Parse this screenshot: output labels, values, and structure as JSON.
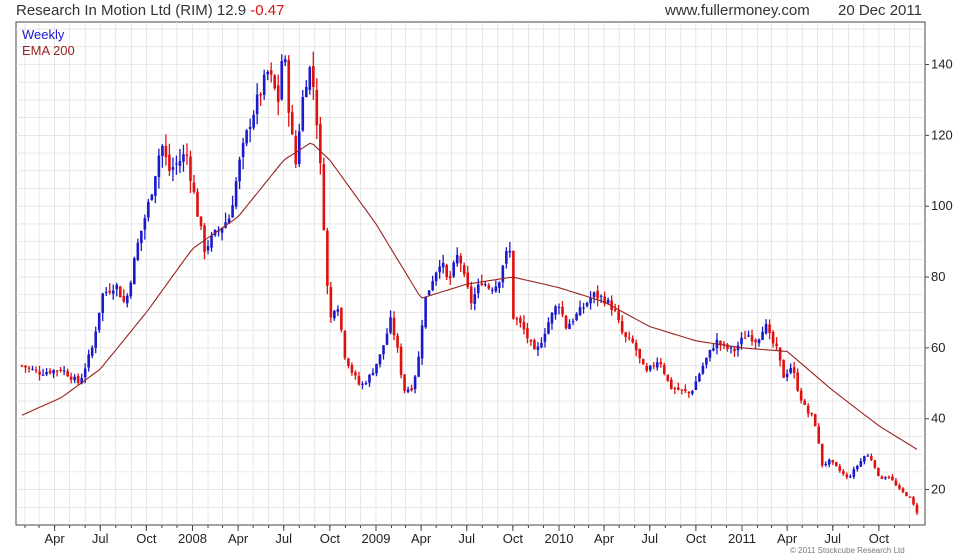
{
  "header": {
    "instrument": "Research In Motion Ltd (RIM)",
    "last": "12.9",
    "change": "-0.47",
    "site": "www.fullermoney.com",
    "date": "20 Dec 2011",
    "copyright": "© 2011 Stockcube Research Ltd"
  },
  "colors": {
    "up": "#1a1acc",
    "down": "#e01010",
    "ema": "#992222",
    "grid": "#d8d8d8",
    "border": "#444444"
  },
  "chart_data": {
    "type": "candlestick",
    "legend": [
      "Weekly",
      "EMA 200"
    ],
    "x_range": [
      "2007-01-26",
      "2011-12-20"
    ],
    "ylim": [
      10,
      152
    ],
    "y_ticks": [
      20,
      40,
      60,
      80,
      100,
      120,
      140
    ],
    "x_ticks": [
      {
        "date": "2007-04-01",
        "label": "Apr"
      },
      {
        "date": "2007-07-01",
        "label": "Jul"
      },
      {
        "date": "2007-10-01",
        "label": "Oct"
      },
      {
        "date": "2008-01-01",
        "label": "2008"
      },
      {
        "date": "2008-04-01",
        "label": "Apr"
      },
      {
        "date": "2008-07-01",
        "label": "Jul"
      },
      {
        "date": "2008-10-01",
        "label": "Oct"
      },
      {
        "date": "2009-01-01",
        "label": "2009"
      },
      {
        "date": "2009-04-01",
        "label": "Apr"
      },
      {
        "date": "2009-07-01",
        "label": "Jul"
      },
      {
        "date": "2009-10-01",
        "label": "Oct"
      },
      {
        "date": "2010-01-01",
        "label": "2010"
      },
      {
        "date": "2010-04-01",
        "label": "Apr"
      },
      {
        "date": "2010-07-01",
        "label": "Jul"
      },
      {
        "date": "2010-10-01",
        "label": "Oct"
      },
      {
        "date": "2011-01-01",
        "label": "2011"
      },
      {
        "date": "2011-04-01",
        "label": "Apr"
      },
      {
        "date": "2011-07-01",
        "label": "Jul"
      },
      {
        "date": "2011-10-01",
        "label": "Oct"
      }
    ],
    "close_anchors": [
      [
        "2007-01-26",
        55
      ],
      [
        "2007-03-01",
        53
      ],
      [
        "2007-04-15",
        54
      ],
      [
        "2007-05-20",
        50
      ],
      [
        "2007-06-15",
        60
      ],
      [
        "2007-07-05",
        75
      ],
      [
        "2007-08-01",
        78
      ],
      [
        "2007-08-20",
        72
      ],
      [
        "2007-09-15",
        90
      ],
      [
        "2007-10-08",
        102
      ],
      [
        "2007-10-31",
        118
      ],
      [
        "2007-11-15",
        110
      ],
      [
        "2007-12-01",
        112
      ],
      [
        "2007-12-20",
        115
      ],
      [
        "2008-01-15",
        95
      ],
      [
        "2008-01-25",
        88
      ],
      [
        "2008-02-15",
        92
      ],
      [
        "2008-03-15",
        97
      ],
      [
        "2008-04-05",
        113
      ],
      [
        "2008-04-25",
        124
      ],
      [
        "2008-05-10",
        130
      ],
      [
        "2008-05-31",
        138
      ],
      [
        "2008-06-20",
        130
      ],
      [
        "2008-06-30",
        146
      ],
      [
        "2008-07-15",
        122
      ],
      [
        "2008-07-25",
        112
      ],
      [
        "2008-08-05",
        128
      ],
      [
        "2008-08-20",
        140
      ],
      [
        "2008-09-01",
        132
      ],
      [
        "2008-09-15",
        105
      ],
      [
        "2008-09-30",
        67
      ],
      [
        "2008-10-15",
        74
      ],
      [
        "2008-10-31",
        58
      ],
      [
        "2008-11-15",
        53
      ],
      [
        "2008-12-01",
        49
      ],
      [
        "2008-12-20",
        52
      ],
      [
        "2009-01-10",
        58
      ],
      [
        "2009-01-31",
        68
      ],
      [
        "2009-02-15",
        58
      ],
      [
        "2009-02-25",
        48
      ],
      [
        "2009-03-15",
        49
      ],
      [
        "2009-03-31",
        60
      ],
      [
        "2009-04-05",
        72
      ],
      [
        "2009-04-25",
        80
      ],
      [
        "2009-05-10",
        85
      ],
      [
        "2009-05-25",
        78
      ],
      [
        "2009-06-15",
        87
      ],
      [
        "2009-06-25",
        80
      ],
      [
        "2009-07-10",
        73
      ],
      [
        "2009-07-31",
        79
      ],
      [
        "2009-08-15",
        77
      ],
      [
        "2009-09-01",
        78
      ],
      [
        "2009-09-15",
        86
      ],
      [
        "2009-09-25",
        87
      ],
      [
        "2009-10-01",
        69
      ],
      [
        "2009-10-20",
        66
      ],
      [
        "2009-11-15",
        58
      ],
      [
        "2009-12-10",
        67
      ],
      [
        "2009-12-31",
        73
      ],
      [
        "2010-01-15",
        66
      ],
      [
        "2010-02-10",
        70
      ],
      [
        "2010-03-10",
        75
      ],
      [
        "2010-03-31",
        74
      ],
      [
        "2010-04-20",
        71
      ],
      [
        "2010-05-10",
        63
      ],
      [
        "2010-05-31",
        61
      ],
      [
        "2010-06-15",
        55
      ],
      [
        "2010-06-25",
        53
      ],
      [
        "2010-07-20",
        57
      ],
      [
        "2010-08-10",
        49
      ],
      [
        "2010-08-31",
        48
      ],
      [
        "2010-09-20",
        47
      ],
      [
        "2010-10-15",
        55
      ],
      [
        "2010-11-10",
        62
      ],
      [
        "2010-11-30",
        60
      ],
      [
        "2010-12-15",
        59
      ],
      [
        "2011-01-10",
        64
      ],
      [
        "2011-01-31",
        62
      ],
      [
        "2011-02-15",
        67
      ],
      [
        "2011-02-28",
        62
      ],
      [
        "2011-03-10",
        60
      ],
      [
        "2011-03-25",
        52
      ],
      [
        "2011-04-10",
        55
      ],
      [
        "2011-04-25",
        47
      ],
      [
        "2011-05-10",
        42
      ],
      [
        "2011-05-25",
        40
      ],
      [
        "2011-06-10",
        27
      ],
      [
        "2011-06-25",
        28
      ],
      [
        "2011-07-10",
        26
      ],
      [
        "2011-07-31",
        23
      ],
      [
        "2011-08-15",
        26
      ],
      [
        "2011-09-05",
        30
      ],
      [
        "2011-09-20",
        28
      ],
      [
        "2011-10-01",
        23
      ],
      [
        "2011-10-20",
        24
      ],
      [
        "2011-11-10",
        20
      ],
      [
        "2011-11-30",
        18
      ],
      [
        "2011-12-15",
        14
      ],
      [
        "2011-12-20",
        12.9
      ]
    ],
    "ema_anchors": [
      [
        "2007-01-26",
        41
      ],
      [
        "2007-04-15",
        46
      ],
      [
        "2007-07-01",
        54
      ],
      [
        "2007-10-01",
        70
      ],
      [
        "2008-01-01",
        88
      ],
      [
        "2008-04-01",
        97
      ],
      [
        "2008-07-01",
        113
      ],
      [
        "2008-08-25",
        118
      ],
      [
        "2008-10-01",
        113
      ],
      [
        "2009-01-01",
        95
      ],
      [
        "2009-04-01",
        74
      ],
      [
        "2009-07-01",
        78
      ],
      [
        "2009-10-01",
        80
      ],
      [
        "2010-01-01",
        77
      ],
      [
        "2010-04-01",
        73
      ],
      [
        "2010-07-01",
        66
      ],
      [
        "2010-10-01",
        62
      ],
      [
        "2011-01-01",
        60
      ],
      [
        "2011-04-01",
        59
      ],
      [
        "2011-07-01",
        48
      ],
      [
        "2011-10-01",
        38
      ],
      [
        "2011-12-20",
        31
      ]
    ]
  }
}
